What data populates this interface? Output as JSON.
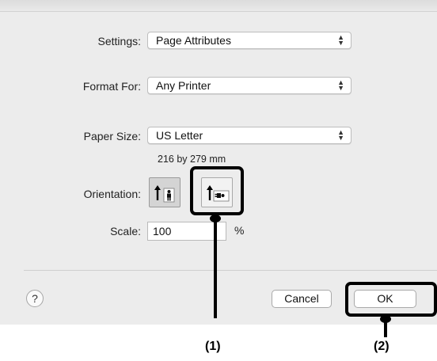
{
  "dialog": {
    "settings": {
      "label": "Settings:",
      "value": "Page Attributes"
    },
    "format_for": {
      "label": "Format For:",
      "value": "Any Printer"
    },
    "paper_size": {
      "label": "Paper Size:",
      "value": "US Letter",
      "dimensions": "216 by 279 mm"
    },
    "orientation": {
      "label": "Orientation:",
      "options": [
        {
          "name": "portrait",
          "selected": true
        },
        {
          "name": "landscape",
          "selected": false
        }
      ]
    },
    "scale": {
      "label": "Scale:",
      "value": "100",
      "unit": "%"
    },
    "help_label": "?",
    "cancel_label": "Cancel",
    "ok_label": "OK"
  },
  "callouts": [
    {
      "label": "(1)",
      "target": "landscape orientation button"
    },
    {
      "label": "(2)",
      "target": "OK button"
    }
  ]
}
